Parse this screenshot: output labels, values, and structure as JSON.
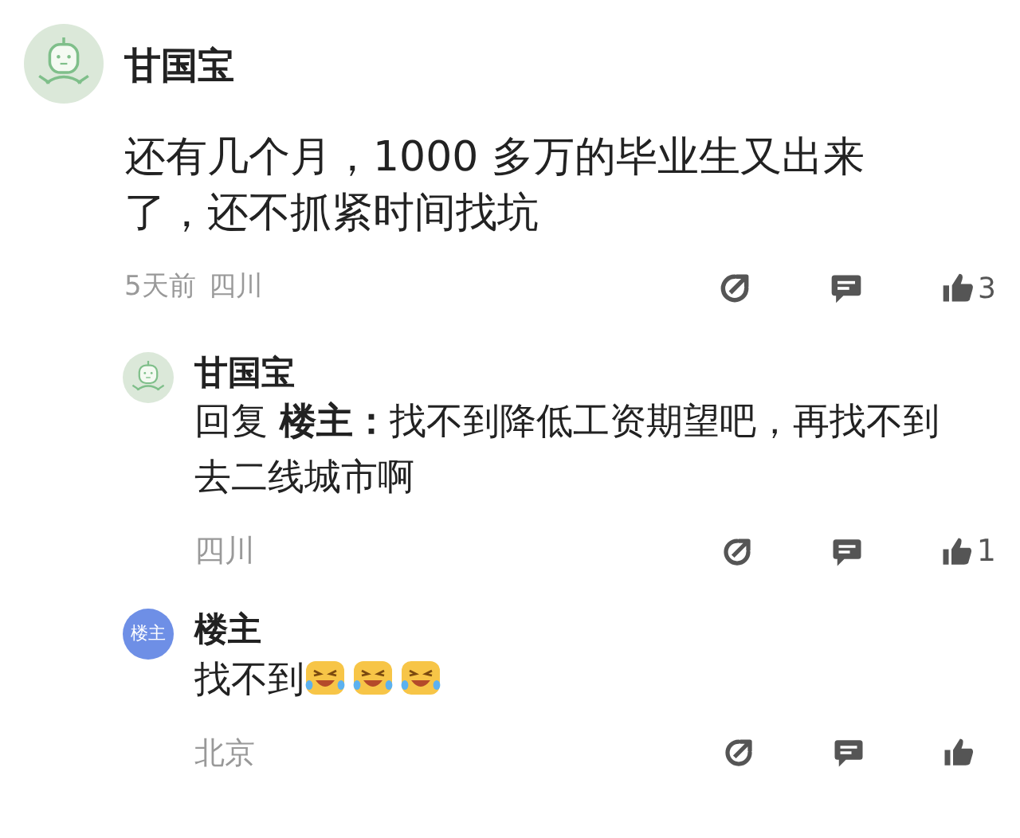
{
  "comments": [
    {
      "author": "甘国宝",
      "avatar": {
        "kind": "robot"
      },
      "body": "还有几个月，1000 多万的毕业生又出来了，还不抓紧时间找坑",
      "time": "5天前",
      "location": "四川",
      "likes": "3",
      "replies": [
        {
          "author": "甘国宝",
          "avatar": {
            "kind": "robot"
          },
          "body": "回复 **楼主：**找不到降低工资期望吧，再找不到去二线城市啊",
          "location": "四川",
          "likes": "1"
        },
        {
          "author": "楼主",
          "avatar": {
            "kind": "label",
            "text": "楼主"
          },
          "body": "找不到",
          "emojis": [
            {
              "kind": "laugh-cry"
            },
            {
              "kind": "laugh-cry"
            },
            {
              "kind": "laugh-cry"
            }
          ],
          "location": "北京"
        }
      ]
    }
  ]
}
